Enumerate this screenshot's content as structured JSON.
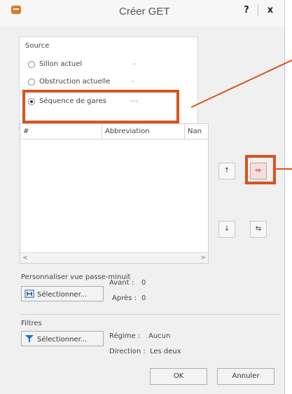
{
  "window": {
    "title": "Créer GET",
    "help": "?",
    "close": "x"
  },
  "source": {
    "group_label": "Source",
    "options": [
      {
        "label": "Sillon actuel",
        "value": "-",
        "selected": false
      },
      {
        "label": "Obstruction actuelle",
        "value": "-",
        "selected": false
      },
      {
        "label": "Séquence de gares",
        "value": "---",
        "selected": true
      }
    ]
  },
  "table": {
    "columns": [
      "#",
      "Abbreviation",
      "Nan"
    ],
    "scroll_left": "<",
    "scroll_right": ">"
  },
  "side_buttons": {
    "up": "↑",
    "down": "↓",
    "invert_label": "⇨",
    "swap_label": "⇆"
  },
  "passe_minuit": {
    "label": "Personnaliser vue passe-minuit",
    "button": "Sélectionner...",
    "avant_label": "Avant :",
    "avant_value": "0",
    "apres_label": "Après :",
    "apres_value": "0"
  },
  "filtres": {
    "label": "Filtres",
    "button": "Sélectionner...",
    "regime_label": "Régime :",
    "regime_value": "Aucun",
    "direction_label": "Direction :",
    "direction_value": "Les deux"
  },
  "footer": {
    "ok": "OK",
    "cancel": "Annuler"
  },
  "colors": {
    "highlight": "#d9541e",
    "filter_icon": "#1f6fcf"
  }
}
